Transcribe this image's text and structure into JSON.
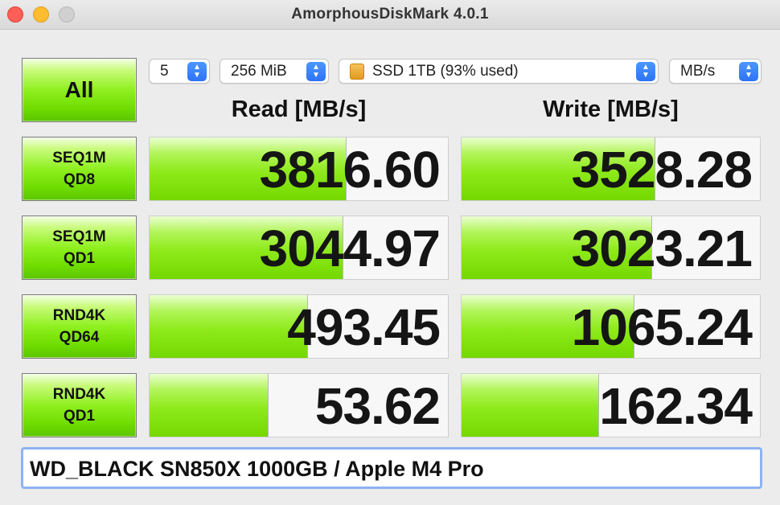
{
  "window": {
    "title": "AmorphousDiskMark 4.0.1"
  },
  "toolbar": {
    "all_label": "All",
    "count": "5",
    "size": "256 MiB",
    "drive": "SSD 1TB (93% used)",
    "unit": "MB/s"
  },
  "headers": {
    "read": "Read [MB/s]",
    "write": "Write [MB/s]"
  },
  "tests": [
    {
      "line1": "SEQ1M",
      "line2": "QD8",
      "read": "3816.60",
      "write": "3528.28",
      "read_fill": 0.66,
      "write_fill": 0.65
    },
    {
      "line1": "SEQ1M",
      "line2": "QD1",
      "read": "3044.97",
      "write": "3023.21",
      "read_fill": 0.65,
      "write_fill": 0.64
    },
    {
      "line1": "RND4K",
      "line2": "QD64",
      "read": "493.45",
      "write": "1065.24",
      "read_fill": 0.53,
      "write_fill": 0.58
    },
    {
      "line1": "RND4K",
      "line2": "QD1",
      "read": "53.62",
      "write": "162.34",
      "read_fill": 0.4,
      "write_fill": 0.46
    }
  ],
  "comment": "WD_BLACK SN850X 1000GB / Apple M4 Pro",
  "colors": {
    "accent": "#8ff01f",
    "select_accent": "#2d73f5",
    "focus_ring": "#8fb2f2"
  }
}
